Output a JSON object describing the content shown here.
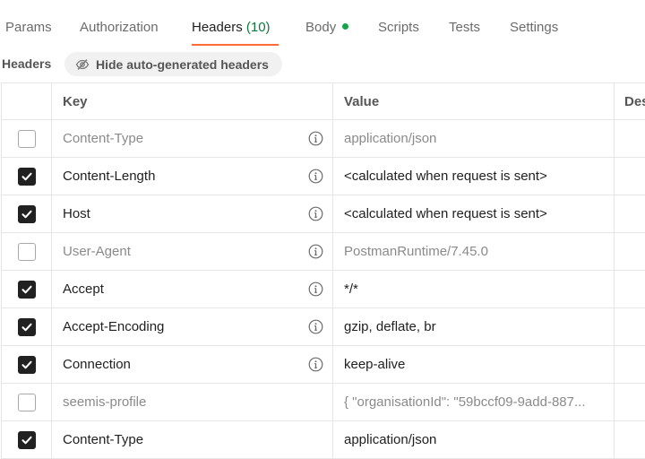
{
  "tabs": [
    {
      "label": "Params"
    },
    {
      "label": "Authorization"
    },
    {
      "label": "Headers",
      "count": "(10)"
    },
    {
      "label": "Body"
    },
    {
      "label": "Scripts"
    },
    {
      "label": "Tests"
    },
    {
      "label": "Settings"
    }
  ],
  "subheader": {
    "title": "Headers",
    "hide_button": "Hide auto-generated headers"
  },
  "table": {
    "columns": {
      "key": "Key",
      "value": "Value",
      "description": "Des"
    },
    "rows": [
      {
        "checked": false,
        "key": "Content-Type",
        "value": "application/json",
        "info": true
      },
      {
        "checked": true,
        "key": "Content-Length",
        "value": "<calculated when request is sent>",
        "info": true
      },
      {
        "checked": true,
        "key": "Host",
        "value": "<calculated when request is sent>",
        "info": true
      },
      {
        "checked": false,
        "key": "User-Agent",
        "value": "PostmanRuntime/7.45.0",
        "info": true
      },
      {
        "checked": true,
        "key": "Accept",
        "value": "*/*",
        "info": true
      },
      {
        "checked": true,
        "key": "Accept-Encoding",
        "value": "gzip, deflate, br",
        "info": true
      },
      {
        "checked": true,
        "key": "Connection",
        "value": "keep-alive",
        "info": true
      },
      {
        "checked": false,
        "key": "seemis-profile",
        "value": "{ \"organisationId\": \"59bccf09-9add-887...",
        "info": false
      },
      {
        "checked": true,
        "key": "Content-Type",
        "value": "application/json",
        "info": false
      }
    ]
  },
  "colors": {
    "accent": "#ff6c37",
    "count": "#0b7a3a",
    "dot": "#16a34a",
    "checked": "#212121"
  }
}
